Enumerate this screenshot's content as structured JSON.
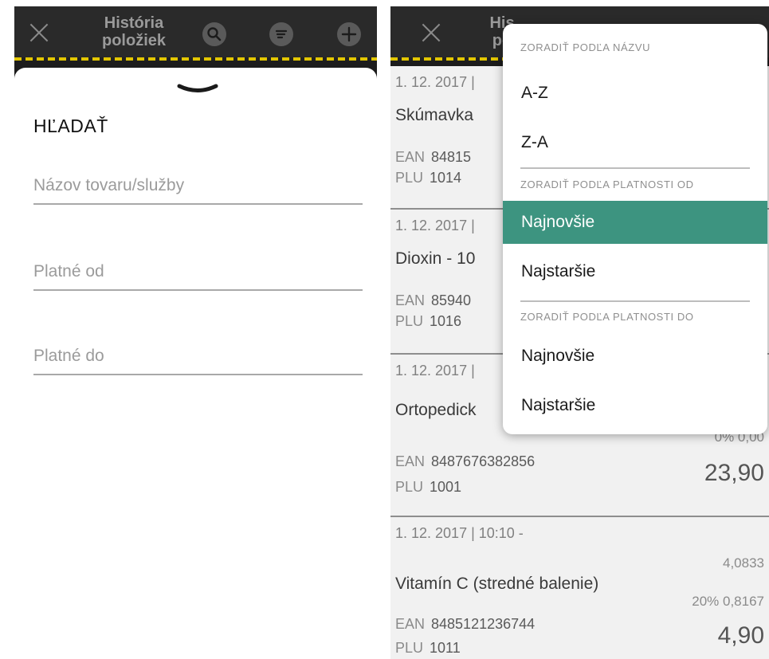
{
  "left": {
    "topbar": {
      "title_line1": "História",
      "title_line2": "položiek"
    },
    "sheet": {
      "heading": "HĽADAŤ",
      "fields": [
        {
          "placeholder": "Názov tovaru/služby"
        },
        {
          "placeholder": "Platné od"
        },
        {
          "placeholder": "Platné do"
        }
      ]
    }
  },
  "right": {
    "topbar": {
      "title_line1": "His",
      "title_line2": "po"
    },
    "items": [
      {
        "meta": "1. 12. 2017 |",
        "name": "Skúmavka",
        "ean_label": "EAN",
        "ean": "84815",
        "plu_label": "PLU",
        "plu": "1014"
      },
      {
        "meta": "1. 12. 2017 |",
        "name": "Dioxin - 10",
        "ean_label": "EAN",
        "ean": "85940",
        "plu_label": "PLU",
        "plu": "1016"
      },
      {
        "meta": "1. 12. 2017 |",
        "name": "Ortopedick",
        "ean_label": "EAN",
        "ean": "8487676382856",
        "plu_label": "PLU",
        "plu": "1001",
        "sub": "0% 0,00",
        "price": "23,90"
      },
      {
        "meta": "1. 12. 2017 | 10:10 -",
        "name": "Vitamín C (stredné balenie)",
        "ean_label": "EAN",
        "ean": "8485121236744",
        "plu_label": "PLU",
        "plu": "1011",
        "sub1": "4,0833",
        "sub2": "20% 0,8167",
        "price": "4,90"
      }
    ],
    "menu": {
      "section_name": "ZORADIŤ PODĽA NÁZVU",
      "opt_az": "A-Z",
      "opt_za": "Z-A",
      "section_from": "ZORADIŤ PODĽA PLATNOSTI OD",
      "opt_from_newest": "Najnovšie",
      "opt_from_oldest": "Najstaršie",
      "section_to": "ZORADIŤ PODĽA PLATNOSTI DO",
      "opt_to_newest": "Najnovšie",
      "opt_to_oldest": "Najstaršie",
      "active_color": "#3d9480"
    }
  },
  "colors": {
    "accent": "#3d9480",
    "stripe": "#e2c600"
  },
  "icons": {
    "close": "close-icon",
    "search": "search-icon",
    "filter": "filter-icon",
    "add": "add-icon",
    "grabber": "chevron-down-icon"
  }
}
